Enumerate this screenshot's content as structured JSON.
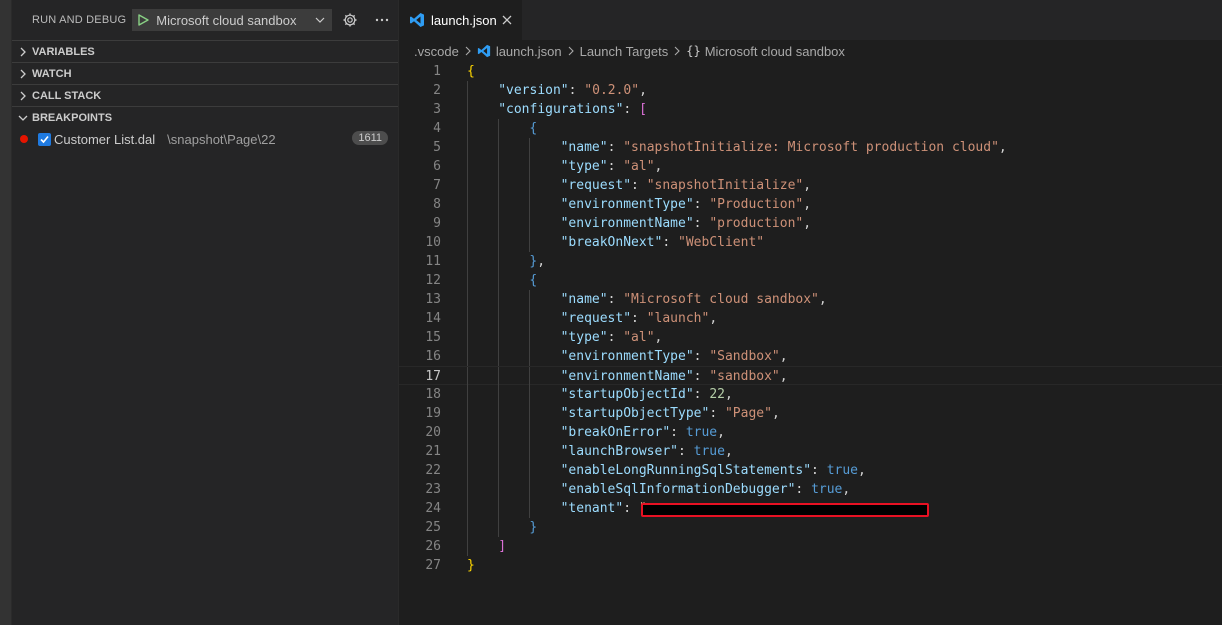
{
  "sidebar": {
    "title": "RUN AND DEBUG",
    "launch_config": "Microsoft cloud sandbox",
    "sections": [
      {
        "label": "VARIABLES",
        "expanded": false
      },
      {
        "label": "WATCH",
        "expanded": false
      },
      {
        "label": "CALL STACK",
        "expanded": false
      },
      {
        "label": "BREAKPOINTS",
        "expanded": true
      }
    ],
    "breakpoint": {
      "file": "Customer List.dal",
      "path": "\\snapshot\\Page\\22",
      "line": "1611",
      "checked": true
    }
  },
  "editor": {
    "tab_label": "launch.json",
    "breadcrumb": {
      "folder": ".vscode",
      "file": "launch.json",
      "section": "Launch Targets",
      "brace": "{}",
      "item": "Microsoft cloud sandbox"
    },
    "current_line": 17,
    "lines": [
      {
        "n": "1",
        "indent": 0,
        "t": [
          [
            "{",
            "y"
          ]
        ]
      },
      {
        "n": "2",
        "indent": 1,
        "t": [
          [
            "\"version\"",
            "k"
          ],
          [
            ": ",
            "p"
          ],
          [
            "\"0.2.0\"",
            "s"
          ],
          [
            ",",
            "p"
          ]
        ]
      },
      {
        "n": "3",
        "indent": 1,
        "t": [
          [
            "\"configurations\"",
            "k"
          ],
          [
            ": ",
            "p"
          ],
          [
            "[",
            "m"
          ]
        ]
      },
      {
        "n": "4",
        "indent": 2,
        "t": [
          [
            "{",
            "b"
          ]
        ]
      },
      {
        "n": "5",
        "indent": 3,
        "t": [
          [
            "\"name\"",
            "k"
          ],
          [
            ": ",
            "p"
          ],
          [
            "\"snapshotInitialize: Microsoft production cloud\"",
            "s"
          ],
          [
            ",",
            "p"
          ]
        ]
      },
      {
        "n": "6",
        "indent": 3,
        "t": [
          [
            "\"type\"",
            "k"
          ],
          [
            ": ",
            "p"
          ],
          [
            "\"al\"",
            "s"
          ],
          [
            ",",
            "p"
          ]
        ]
      },
      {
        "n": "7",
        "indent": 3,
        "t": [
          [
            "\"request\"",
            "k"
          ],
          [
            ": ",
            "p"
          ],
          [
            "\"snapshotInitialize\"",
            "s"
          ],
          [
            ",",
            "p"
          ]
        ]
      },
      {
        "n": "8",
        "indent": 3,
        "t": [
          [
            "\"environmentType\"",
            "k"
          ],
          [
            ": ",
            "p"
          ],
          [
            "\"Production\"",
            "s"
          ],
          [
            ",",
            "p"
          ]
        ]
      },
      {
        "n": "9",
        "indent": 3,
        "t": [
          [
            "\"environmentName\"",
            "k"
          ],
          [
            ": ",
            "p"
          ],
          [
            "\"production\"",
            "s"
          ],
          [
            ",",
            "p"
          ]
        ]
      },
      {
        "n": "10",
        "indent": 3,
        "t": [
          [
            "\"breakOnNext\"",
            "k"
          ],
          [
            ": ",
            "p"
          ],
          [
            "\"WebClient\"",
            "s"
          ]
        ]
      },
      {
        "n": "11",
        "indent": 2,
        "t": [
          [
            "}",
            "b"
          ],
          [
            ",",
            "p"
          ]
        ]
      },
      {
        "n": "12",
        "indent": 2,
        "t": [
          [
            "{",
            "b"
          ]
        ]
      },
      {
        "n": "13",
        "indent": 3,
        "t": [
          [
            "\"name\"",
            "k"
          ],
          [
            ": ",
            "p"
          ],
          [
            "\"Microsoft cloud sandbox\"",
            "s"
          ],
          [
            ",",
            "p"
          ]
        ]
      },
      {
        "n": "14",
        "indent": 3,
        "t": [
          [
            "\"request\"",
            "k"
          ],
          [
            ": ",
            "p"
          ],
          [
            "\"launch\"",
            "s"
          ],
          [
            ",",
            "p"
          ]
        ]
      },
      {
        "n": "15",
        "indent": 3,
        "t": [
          [
            "\"type\"",
            "k"
          ],
          [
            ": ",
            "p"
          ],
          [
            "\"al\"",
            "s"
          ],
          [
            ",",
            "p"
          ]
        ]
      },
      {
        "n": "16",
        "indent": 3,
        "t": [
          [
            "\"environmentType\"",
            "k"
          ],
          [
            ": ",
            "p"
          ],
          [
            "\"Sandbox\"",
            "s"
          ],
          [
            ",",
            "p"
          ]
        ]
      },
      {
        "n": "17",
        "indent": 3,
        "t": [
          [
            "\"environmentName\"",
            "k"
          ],
          [
            ": ",
            "p"
          ],
          [
            "\"sandbox\"",
            "s"
          ],
          [
            ",",
            "p"
          ]
        ]
      },
      {
        "n": "18",
        "indent": 3,
        "t": [
          [
            "\"startupObjectId\"",
            "k"
          ],
          [
            ": ",
            "p"
          ],
          [
            "22",
            "n"
          ],
          [
            ",",
            "p"
          ]
        ]
      },
      {
        "n": "19",
        "indent": 3,
        "t": [
          [
            "\"startupObjectType\"",
            "k"
          ],
          [
            ": ",
            "p"
          ],
          [
            "\"Page\"",
            "s"
          ],
          [
            ",",
            "p"
          ]
        ]
      },
      {
        "n": "20",
        "indent": 3,
        "t": [
          [
            "\"breakOnError\"",
            "k"
          ],
          [
            ": ",
            "p"
          ],
          [
            "true",
            "b"
          ],
          [
            ",",
            "p"
          ]
        ]
      },
      {
        "n": "21",
        "indent": 3,
        "t": [
          [
            "\"launchBrowser\"",
            "k"
          ],
          [
            ": ",
            "p"
          ],
          [
            "true",
            "b"
          ],
          [
            ",",
            "p"
          ]
        ]
      },
      {
        "n": "22",
        "indent": 3,
        "t": [
          [
            "\"enableLongRunningSqlStatements\"",
            "k"
          ],
          [
            ": ",
            "p"
          ],
          [
            "true",
            "b"
          ],
          [
            ",",
            "p"
          ]
        ]
      },
      {
        "n": "23",
        "indent": 3,
        "t": [
          [
            "\"enableSqlInformationDebugger\"",
            "k"
          ],
          [
            ": ",
            "p"
          ],
          [
            "true",
            "b"
          ],
          [
            ",",
            "p"
          ]
        ]
      },
      {
        "n": "24",
        "indent": 3,
        "t": [
          [
            "\"tenant\"",
            "k"
          ],
          [
            ": ",
            "p"
          ],
          [
            "\"",
            "s"
          ]
        ]
      },
      {
        "n": "25",
        "indent": 2,
        "t": [
          [
            "}",
            "b"
          ]
        ]
      },
      {
        "n": "26",
        "indent": 1,
        "t": [
          [
            "]",
            "m"
          ]
        ]
      },
      {
        "n": "27",
        "indent": 0,
        "t": [
          [
            "}",
            "y"
          ]
        ]
      }
    ]
  },
  "colors": {
    "key": "#9cdcfe",
    "string": "#ce9178",
    "number": "#b5cea8",
    "keyword": "#569cd6",
    "breakpoint": "#e51400",
    "redaction_border": "#e81123"
  },
  "icons": {
    "play": "play-icon",
    "gear": "gear-icon",
    "more": "more-icon",
    "chevron": "chevron-icon",
    "vscode": "vscode-logo-icon",
    "close": "close-icon"
  }
}
